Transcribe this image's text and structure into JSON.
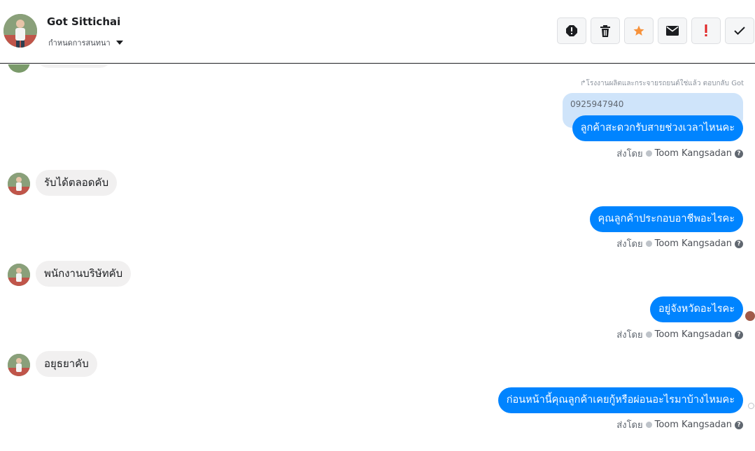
{
  "header": {
    "contact_name": "Got Sittichai",
    "assign_label": "กำหนดการสนทนา",
    "actions": [
      "flag-icon",
      "trash-icon",
      "star-icon",
      "mail-icon",
      "exclamation-icon",
      "check-icon"
    ]
  },
  "reply": {
    "meta": "โรงงานผลิตและกระจายรถยนต์ใช่แล้ว ตอบกลับ Got",
    "quoted_text": "0925947940"
  },
  "messages": [
    {
      "direction": "out",
      "text": "ลูกค้าสะดวกรับสายช่วงเวลาไหนคะ"
    },
    {
      "direction": "in",
      "text": "รับได้ตลอดคับ"
    },
    {
      "direction": "out",
      "text": "คุณลูกค้าประกอบอาชีพอะไรคะ"
    },
    {
      "direction": "in",
      "text": "พนักงานบริษัทคับ"
    },
    {
      "direction": "out",
      "text": "อยู่จังหวัดอะไรคะ"
    },
    {
      "direction": "in",
      "text": "อยุธยาคับ"
    },
    {
      "direction": "out",
      "text": "ก่อนหน้านี้คุณลูกค้าเคยกู้หรือผ่อนอะไรมาบ้างไหมคะ"
    }
  ],
  "sent_by": {
    "label": "ส่งโดย",
    "agent": "Toom Kangsadan"
  },
  "colors": {
    "accent": "#0084ff",
    "incoming_bubble": "#f1f0f0",
    "quoted_bg": "#cfe4fa",
    "star": "#f7923b",
    "alert": "#e02424"
  }
}
